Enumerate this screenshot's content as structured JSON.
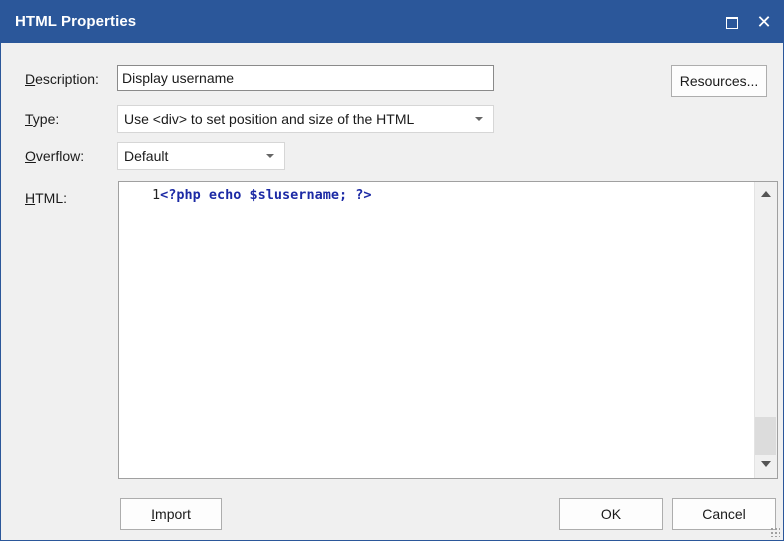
{
  "window": {
    "title": "HTML Properties",
    "maximize_glyph": "maximize-icon",
    "close_glyph": "✕"
  },
  "fields": {
    "description": {
      "label_u": "D",
      "label_rest": "escription:",
      "value": "Display username"
    },
    "type": {
      "label_u": "T",
      "label_rest": "ype:",
      "value": "Use <div> to set position and size of the HTML"
    },
    "overflow": {
      "label_u": "O",
      "label_rest": "verflow:",
      "value": "Default"
    },
    "html": {
      "label_u": "H",
      "label_rest": "TML:"
    }
  },
  "editor": {
    "line_number": "1",
    "code": "<?php echo $slusername; ?>"
  },
  "buttons": {
    "resources": "Resources...",
    "import_u": "I",
    "import_rest": "mport",
    "ok": "OK",
    "cancel": "Cancel"
  },
  "colors": {
    "titlebar": "#2b579a",
    "code_text": "#1c2aa5",
    "dialog_bg": "#f0f0f0"
  }
}
